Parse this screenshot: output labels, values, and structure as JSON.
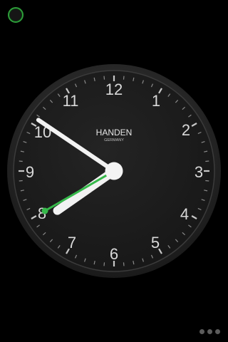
{
  "status": {
    "indicator_icon": "ring-icon",
    "accent": "#2e9e3a"
  },
  "clock": {
    "brand": "HANDEN",
    "origin": "GERMANY",
    "numerals": [
      "12",
      "1",
      "2",
      "3",
      "4",
      "5",
      "6",
      "7",
      "8",
      "9",
      "10",
      "11"
    ],
    "time": {
      "hour": 7,
      "minute": 50,
      "second": 40
    },
    "colors": {
      "face": "#1d1d1d",
      "bezel": "#2b2b2b",
      "text": "#d9d9d9",
      "hands": "#f2f2f2",
      "second_hand": "#36b84a"
    }
  },
  "pager": {
    "count": 3,
    "active": 0
  }
}
